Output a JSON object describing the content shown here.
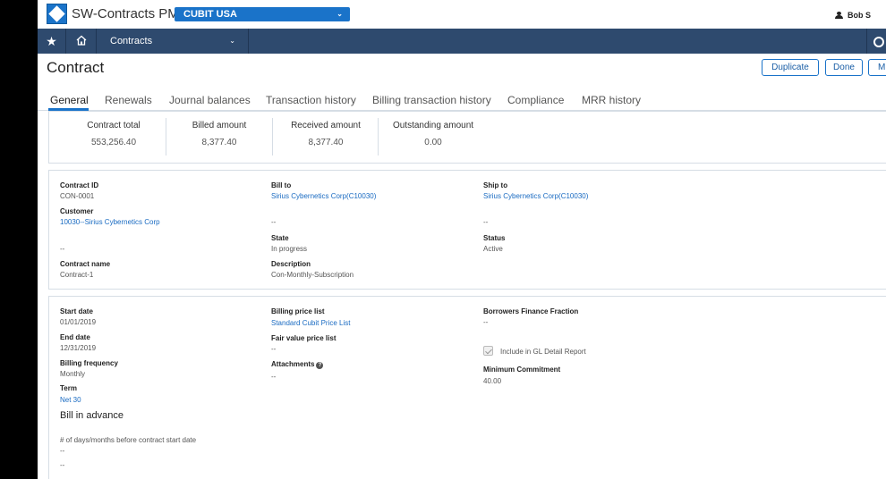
{
  "header": {
    "app_title": "SW-Contracts PMM",
    "entity": "CUBIT USA",
    "user": "Bob S"
  },
  "nav": {
    "module": "Contracts"
  },
  "page": {
    "title": "Contract",
    "buttons": {
      "duplicate": "Duplicate",
      "done": "Done",
      "more": "M"
    }
  },
  "tabs": [
    "General",
    "Renewals",
    "Journal balances",
    "Transaction history",
    "Billing transaction history",
    "Compliance",
    "MRR history"
  ],
  "summary": [
    {
      "label": "Contract total",
      "value": "553,256.40"
    },
    {
      "label": "Billed amount",
      "value": "8,377.40"
    },
    {
      "label": "Received amount",
      "value": "8,377.40"
    },
    {
      "label": "Outstanding amount",
      "value": "0.00"
    }
  ],
  "details": {
    "contract_id_label": "Contract ID",
    "contract_id": "CON-0001",
    "customer_label": "Customer",
    "customer": "10030--Sirius Cybernetics Corp",
    "customer_sub": "--",
    "contract_name_label": "Contract name",
    "contract_name": "Contract-1",
    "bill_to_label": "Bill to",
    "bill_to": "Sirius Cybernetics Corp(C10030)",
    "bill_to_sub": "--",
    "state_label": "State",
    "state": "In progress",
    "description_label": "Description",
    "description": "Con-Monthly-Subscription",
    "ship_to_label": "Ship to",
    "ship_to": "Sirius Cybernetics Corp(C10030)",
    "ship_to_sub": "--",
    "status_label": "Status",
    "status": "Active"
  },
  "billing": {
    "start_date_label": "Start date",
    "start_date": "01/01/2019",
    "end_date_label": "End date",
    "end_date": "12/31/2019",
    "billing_frequency_label": "Billing frequency",
    "billing_frequency": "Monthly",
    "term_label": "Term",
    "term": "Net 30",
    "bill_in_advance": "Bill in advance",
    "days_before_label": "# of days/months before contract start date",
    "days_before_1": "--",
    "days_before_2": "--",
    "billing_price_list_label": "Billing price list",
    "billing_price_list": "Standard Cubit Price List",
    "fair_value_label": "Fair value price list",
    "fair_value": "--",
    "attachments_label": "Attachments",
    "attachments_help": "?",
    "attachments": "--",
    "borrowers_label": "Borrowers Finance Fraction",
    "borrowers": "--",
    "gl_report_label": "Include in GL Detail Report",
    "gl_report_checked": true,
    "min_commitment_label": "Minimum Commitment",
    "min_commitment": "40.00"
  }
}
